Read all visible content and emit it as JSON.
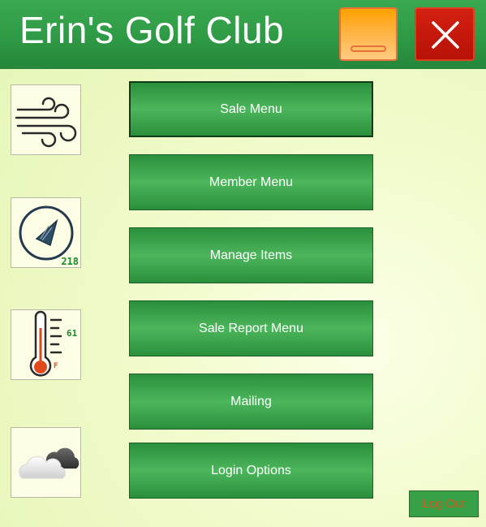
{
  "window": {
    "title": "Erin's Golf Club"
  },
  "titlebar": {
    "minimize_icon": "minimize-icon",
    "close_icon": "close-icon"
  },
  "weather": {
    "wind_icon": "wind-icon",
    "compass_icon": "compass-icon",
    "wind_direction": "218",
    "thermometer_icon": "thermometer-icon",
    "temperature": "61",
    "temperature_unit": "F",
    "condition_icon": "partly-cloudy-icon"
  },
  "menu": {
    "items": [
      {
        "label": "Sale Menu"
      },
      {
        "label": "Member Menu"
      },
      {
        "label": "Manage Items"
      },
      {
        "label": "Sale Report Menu"
      },
      {
        "label": "Mailing"
      },
      {
        "label": "Login Options"
      }
    ]
  },
  "footer": {
    "logout_label": "Log Out"
  },
  "colors": {
    "title_bar": "#2f9a45",
    "button_green": "#3aa54b",
    "minimize_orange": "#ffa200",
    "close_red": "#c4180b",
    "logout_text": "#d9541e"
  }
}
